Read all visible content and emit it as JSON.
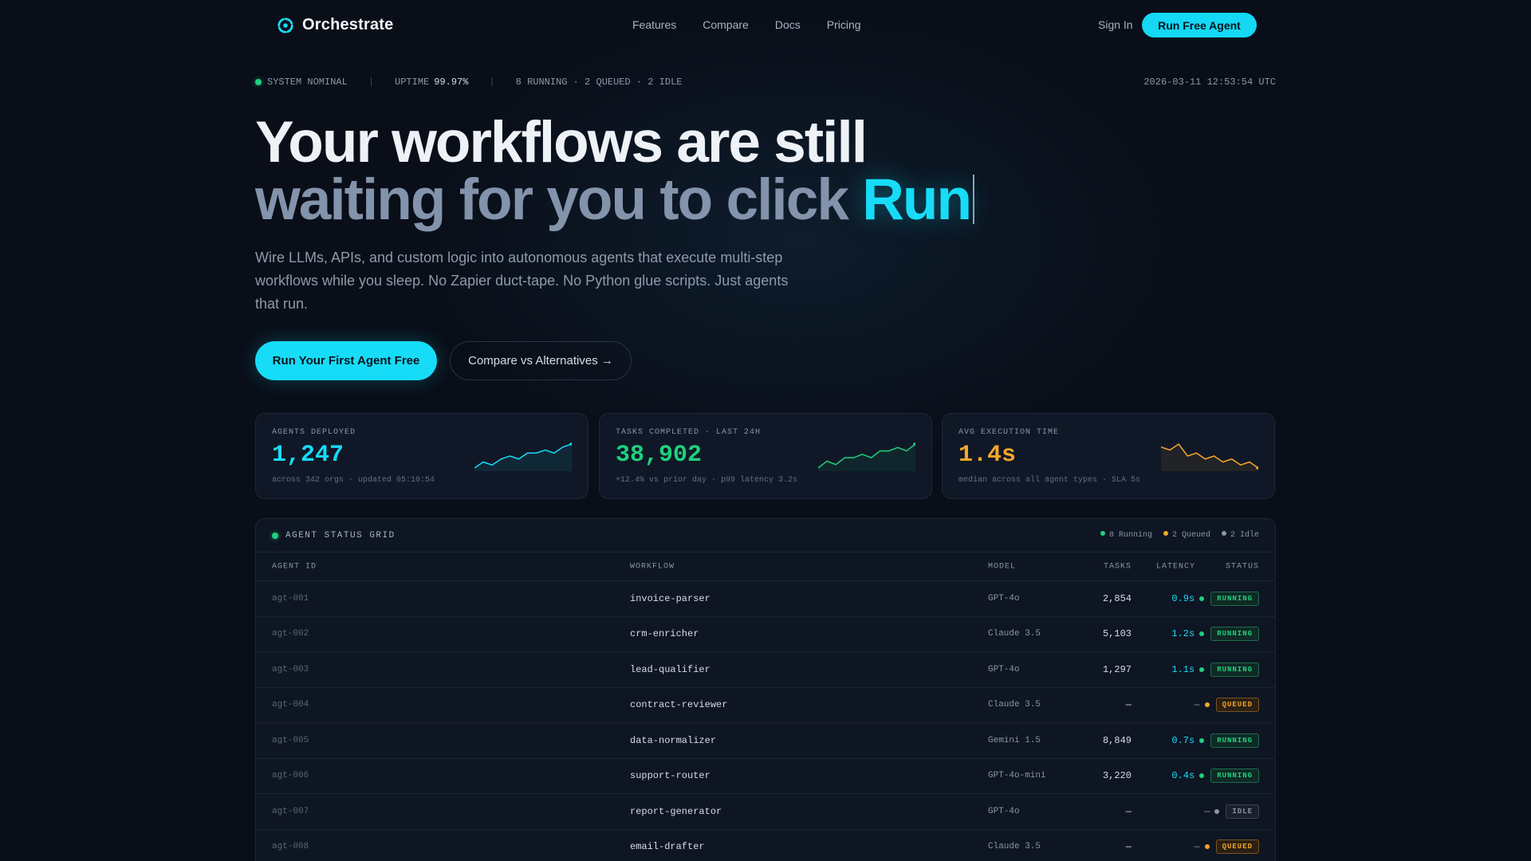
{
  "brand": {
    "name": "Orchestrate"
  },
  "nav": {
    "links": [
      "Features",
      "Compare",
      "Docs",
      "Pricing"
    ],
    "signin": "Sign In",
    "cta": "Run Free Agent"
  },
  "statusbar": {
    "system": "SYSTEM NOMINAL",
    "uptime_label": "UPTIME",
    "uptime_value": "99.97%",
    "counts": "8 RUNNING · 2 QUEUED · 2 IDLE",
    "timestamp": "2026-03-11 12:53:54 UTC"
  },
  "hero": {
    "line1": "Your workflows are still",
    "line2": "waiting for you to click ",
    "accent": "Run",
    "subtitle": "Wire LLMs, APIs, and custom logic into autonomous agents that execute multi-step workflows while you sleep. No Zapier duct-tape. No Python glue scripts. Just agents that run.",
    "primary_cta": "Run Your First Agent Free",
    "secondary_cta": "Compare vs Alternatives →"
  },
  "stats": [
    {
      "label": "AGENTS DEPLOYED",
      "value": "1,247",
      "meta": "across 342 orgs · updated 05:10:54",
      "color": "#17dcf8",
      "trend": [
        4,
        6,
        5,
        7,
        8,
        7,
        9,
        9,
        10,
        9,
        11,
        12
      ]
    },
    {
      "label": "TASKS COMPLETED · LAST 24H",
      "value": "38,902",
      "meta": "+12.4% vs prior day · p99 latency 3.2s",
      "color": "#1fd17d",
      "trend": [
        3,
        5,
        4,
        6,
        6,
        7,
        6,
        8,
        8,
        9,
        8,
        10
      ]
    },
    {
      "label": "AVG EXECUTION TIME",
      "value": "1.4s",
      "meta": "median across all agent types · SLA 5s",
      "color": "#f2a629",
      "trend": [
        10,
        9,
        11,
        7,
        8,
        6,
        7,
        5,
        6,
        4,
        5,
        3
      ]
    }
  ],
  "grid": {
    "title": "AGENT STATUS GRID",
    "legend": [
      {
        "label": "8 Running",
        "color": "#1fd17d"
      },
      {
        "label": "2 Queued",
        "color": "#f2a629"
      },
      {
        "label": "2 Idle",
        "color": "#8b95a5"
      }
    ],
    "columns": [
      "AGENT ID",
      "WORKFLOW",
      "MODEL",
      "TASKS",
      "LATENCY",
      "STATUS"
    ],
    "rows": [
      {
        "id": "agt-001",
        "workflow": "invoice-parser",
        "model": "GPT-4o",
        "tasks": "2,854",
        "latency": "0.9s",
        "status": "RUNNING"
      },
      {
        "id": "agt-002",
        "workflow": "crm-enricher",
        "model": "Claude 3.5",
        "tasks": "5,103",
        "latency": "1.2s",
        "status": "RUNNING"
      },
      {
        "id": "agt-003",
        "workflow": "lead-qualifier",
        "model": "GPT-4o",
        "tasks": "1,297",
        "latency": "1.1s",
        "status": "RUNNING"
      },
      {
        "id": "agt-004",
        "workflow": "contract-reviewer",
        "model": "Claude 3.5",
        "tasks": "—",
        "latency": "—",
        "status": "QUEUED"
      },
      {
        "id": "agt-005",
        "workflow": "data-normalizer",
        "model": "Gemini 1.5",
        "tasks": "8,849",
        "latency": "0.7s",
        "status": "RUNNING"
      },
      {
        "id": "agt-006",
        "workflow": "support-router",
        "model": "GPT-4o-mini",
        "tasks": "3,220",
        "latency": "0.4s",
        "status": "RUNNING"
      },
      {
        "id": "agt-007",
        "workflow": "report-generator",
        "model": "GPT-4o",
        "tasks": "—",
        "latency": "—",
        "status": "IDLE"
      },
      {
        "id": "agt-008",
        "workflow": "email-drafter",
        "model": "Claude 3.5",
        "tasks": "—",
        "latency": "—",
        "status": "QUEUED"
      }
    ]
  },
  "colors": {
    "accent": "#17dcf8",
    "running": "#1fd17d",
    "queued": "#f2a629",
    "idle": "#8b95a5",
    "background": "#090e18"
  }
}
